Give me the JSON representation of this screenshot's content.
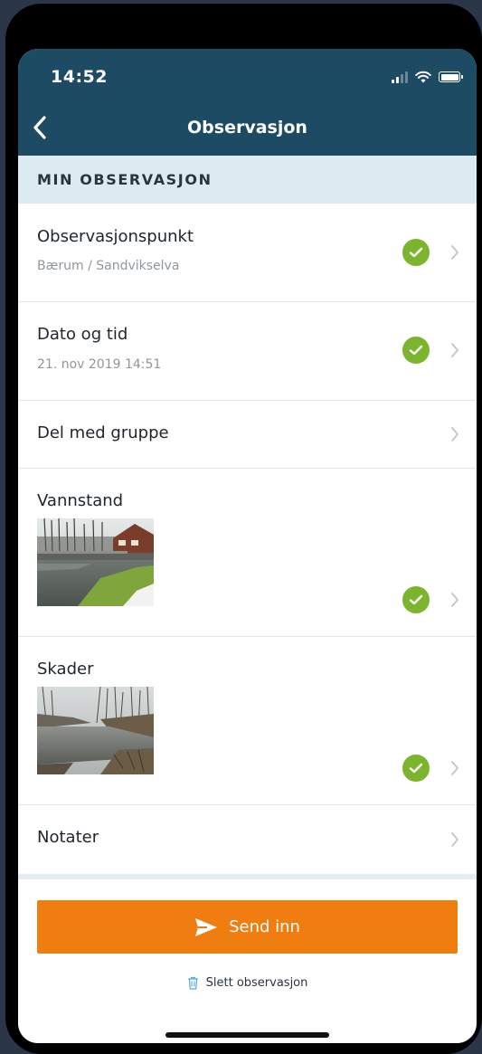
{
  "status_bar": {
    "time": "14:52"
  },
  "nav": {
    "title": "Observasjon"
  },
  "section": {
    "title": "MIN OBSERVASJON"
  },
  "rows": [
    {
      "title": "Observasjonspunkt",
      "subtitle": "Bærum / Sandvikselva",
      "complete": true
    },
    {
      "title": "Dato og tid",
      "subtitle": "21. nov 2019 14:51",
      "complete": true
    },
    {
      "title": "Del med gruppe",
      "complete": false
    },
    {
      "title": "Vannstand",
      "complete": true
    },
    {
      "title": "Skader",
      "complete": true
    },
    {
      "title": "Notater",
      "complete": false
    }
  ],
  "actions": {
    "send_label": "Send inn",
    "delete_label": "Slett observasjon"
  },
  "colors": {
    "header": "#1c4b63",
    "section_bg": "#dcebf1",
    "check": "#7bb52e",
    "send_button": "#ef7d10"
  },
  "icons": [
    "back-chevron-icon",
    "check-circle-icon",
    "chevron-right-icon",
    "send-icon",
    "trash-icon",
    "signal-icon",
    "wifi-icon",
    "battery-icon"
  ]
}
